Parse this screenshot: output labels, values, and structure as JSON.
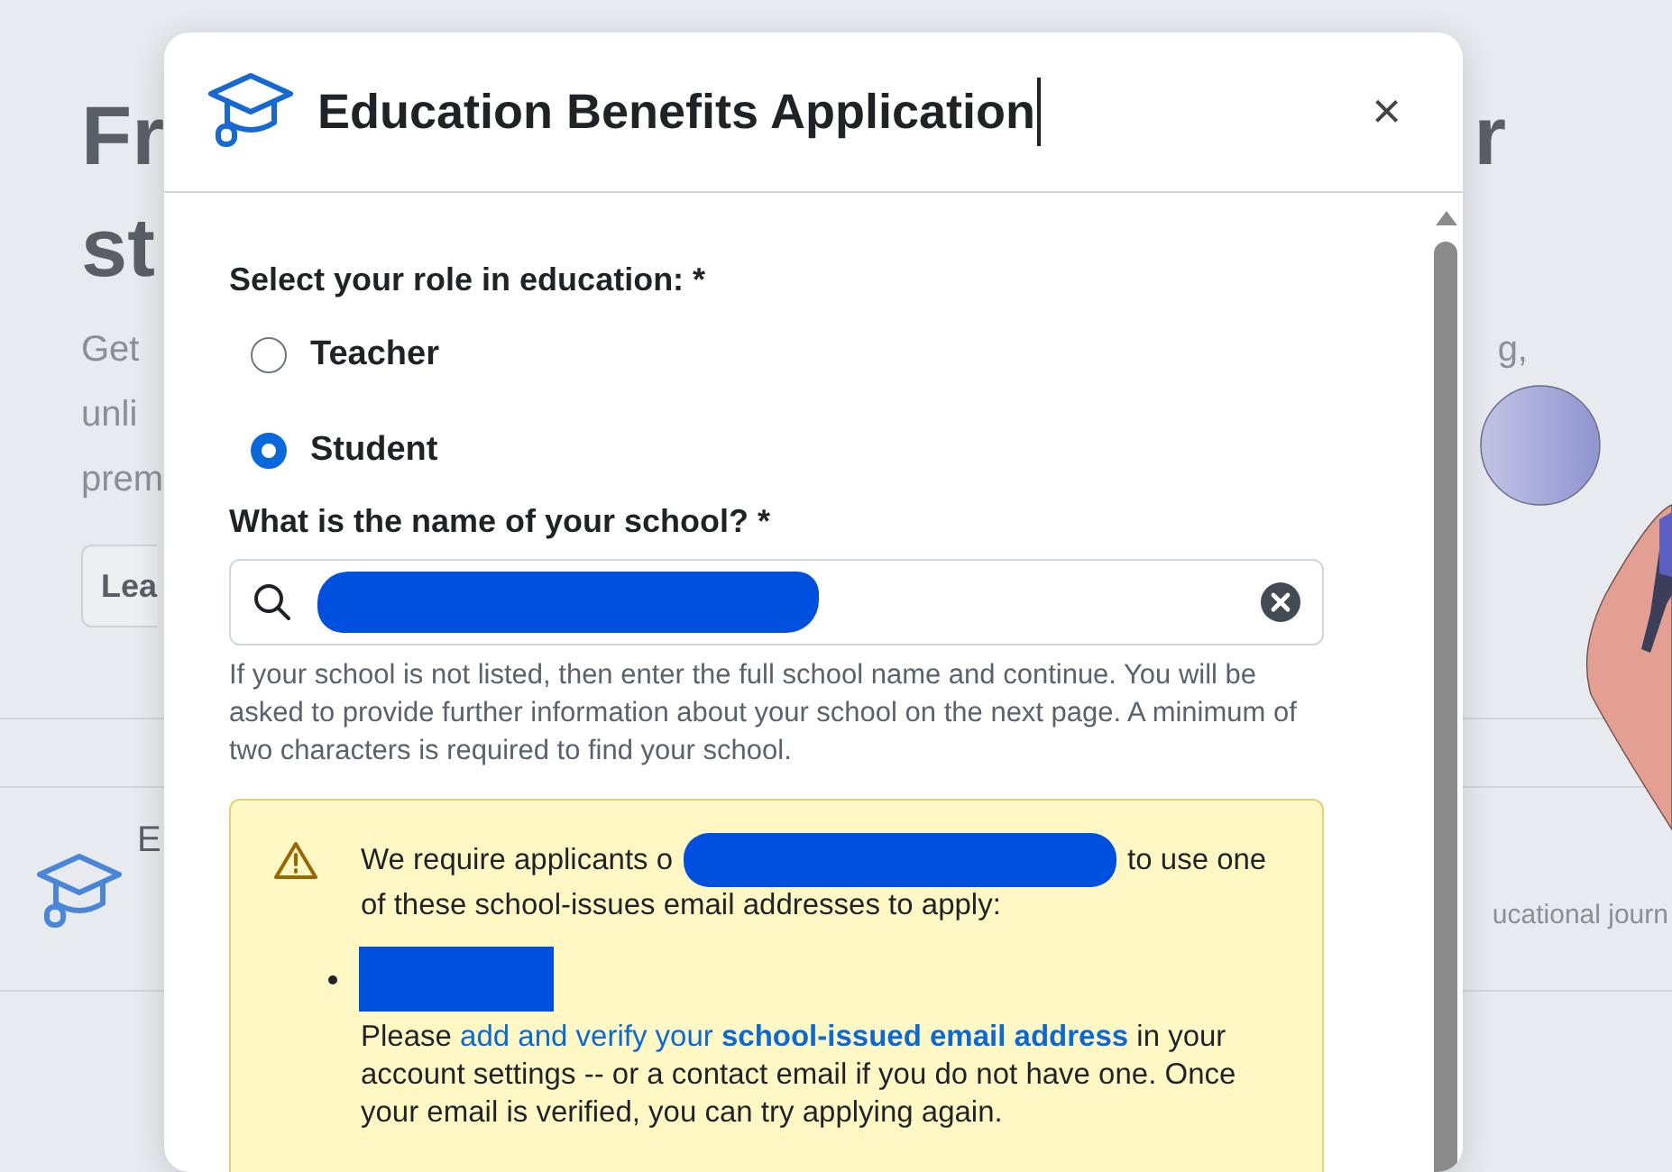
{
  "background": {
    "heading_left": [
      "Fr",
      "st"
    ],
    "heading_right": "r",
    "intro_left": [
      "Get",
      "unli",
      "prem"
    ],
    "intro_right": "g,",
    "button": "Lea",
    "feature_title": "E",
    "feature_text": "ucational journ"
  },
  "dialog": {
    "title": "Education Benefits Application",
    "close": "×",
    "role_question": "Select your role in education: *",
    "roles": [
      {
        "label": "Teacher",
        "selected": false
      },
      {
        "label": "Student",
        "selected": true
      }
    ],
    "school_question": "What is the name of your school? *",
    "school_hint": "If your school is not listed, then enter the full school name and continue. You will be asked to provide further information about your school on the next page. A minimum of two characters is required to find your school.",
    "notice": {
      "text_before": "We require applicants o",
      "text_after": "to use one",
      "text_second_line": "of these school-issues email addresses to apply:",
      "message_before": "Please ",
      "link": "add and verify your **school-issued email address**",
      "message_after": " in your account settings -- or a contact email if you do not have one. Once your email is verified, you can try applying again."
    }
  }
}
